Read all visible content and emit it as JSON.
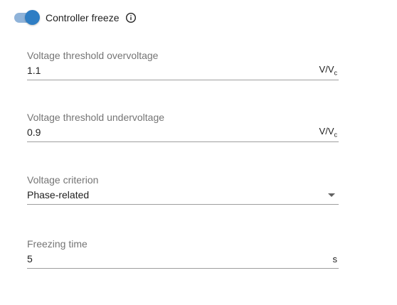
{
  "controller_freeze": {
    "label": "Controller freeze",
    "enabled": true,
    "info_icon": "info-icon",
    "accent_color": "#2f7ec4"
  },
  "fields": {
    "overvoltage": {
      "label": "Voltage threshold overvoltage",
      "value": "1.1",
      "unit_main": "V/V",
      "unit_sub": "c"
    },
    "undervoltage": {
      "label": "Voltage threshold undervoltage",
      "value": "0.9",
      "unit_main": "V/V",
      "unit_sub": "c"
    },
    "criterion": {
      "label": "Voltage criterion",
      "value": "Phase-related",
      "icon": "chevron-down-icon"
    },
    "freezing_time": {
      "label": "Freezing time",
      "value": "5",
      "unit": "s"
    }
  }
}
